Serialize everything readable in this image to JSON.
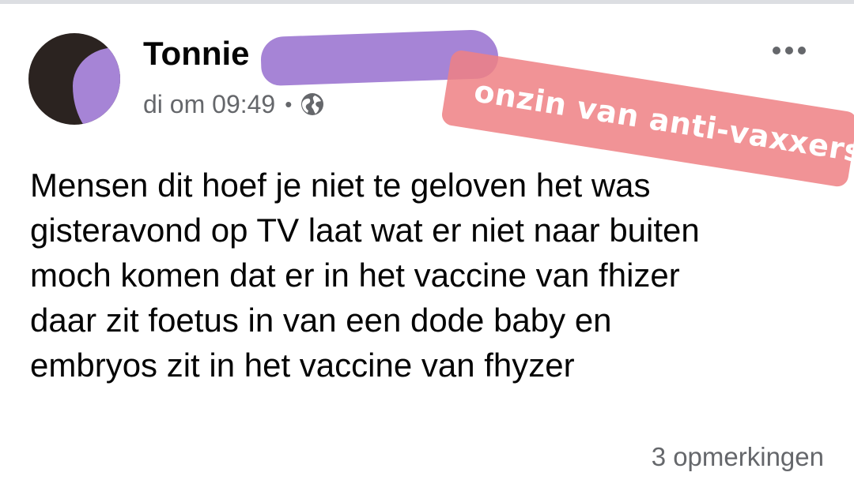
{
  "post": {
    "author_name": "Tonnie",
    "timestamp": "di om 09:49",
    "separator": "•",
    "audience_icon": "globe-icon",
    "body": "Mensen dit hoef je niet te geloven het was\ngisteravond op TV laat wat er niet naar buiten\nmoch komen dat er in het vaccine van fhizer\ndaar zit foetus in van een dode baby en\nembryos zit in het vaccine van fhyzer",
    "comment_count_label": "3 opmerkingen",
    "more_icon": "more-options-icon"
  },
  "annotation": {
    "sticker_text": "onzin van anti-vaxxers",
    "sticker_color": "#ef8084"
  },
  "colors": {
    "redaction": "#a684d6",
    "secondary_text": "#65676b",
    "primary_text": "#050505"
  }
}
